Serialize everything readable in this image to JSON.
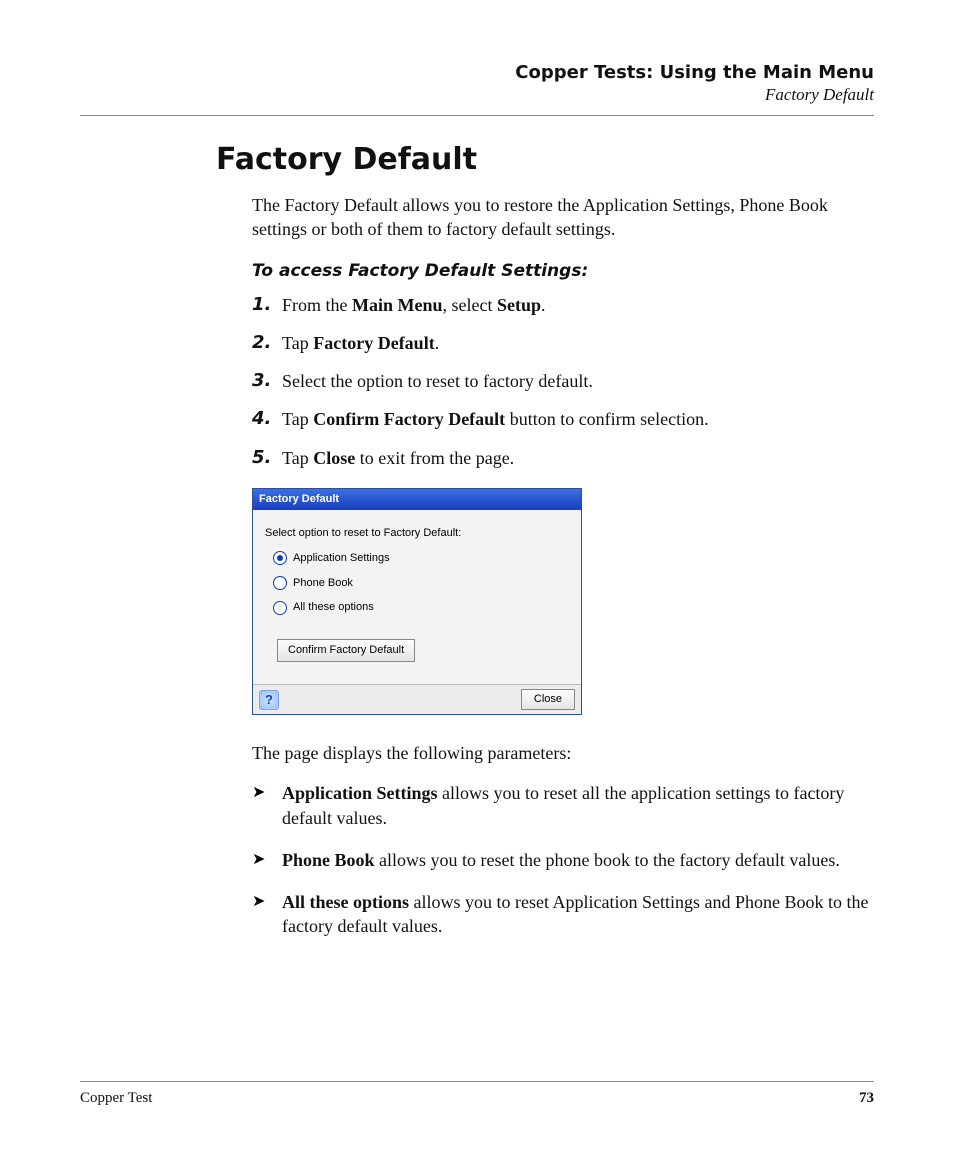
{
  "running_header": {
    "chapter": "Copper Tests: Using the Main Menu",
    "section": "Factory Default"
  },
  "title": "Factory Default",
  "intro": "The Factory Default allows you to restore the Application Settings, Phone Book settings or both of them to factory default settings.",
  "subhead": "To access Factory Default Settings:",
  "steps": [
    {
      "num": "1.",
      "pre": "From the ",
      "b1": "Main Menu",
      "mid": ", select ",
      "b2": "Setup",
      "post": "."
    },
    {
      "num": "2.",
      "pre": "Tap ",
      "b1": "Factory Default",
      "mid": "",
      "b2": "",
      "post": "."
    },
    {
      "num": "3.",
      "pre": "Select the option to reset to factory default.",
      "b1": "",
      "mid": "",
      "b2": "",
      "post": ""
    },
    {
      "num": "4.",
      "pre": "Tap ",
      "b1": "Confirm Factory Default",
      "mid": " button to confirm selection.",
      "b2": "",
      "post": ""
    },
    {
      "num": "5.",
      "pre": "Tap ",
      "b1": "Close",
      "mid": " to exit from the page.",
      "b2": "",
      "post": ""
    }
  ],
  "ui": {
    "title": "Factory Default",
    "prompt": "Select option to reset to Factory Default:",
    "options": [
      {
        "label": "Application Settings",
        "checked": true
      },
      {
        "label": "Phone Book",
        "checked": false
      },
      {
        "label": "All these options",
        "checked": false
      }
    ],
    "confirm_label": "Confirm Factory Default",
    "help_glyph": "?",
    "close_label": "Close"
  },
  "params_intro": "The page displays the following parameters:",
  "params": [
    {
      "b": "Application Settings",
      "rest": " allows you to reset all the application settings to factory default values."
    },
    {
      "b": "Phone Book",
      "rest": " allows you to reset the phone book to the factory default values."
    },
    {
      "b": "All these options",
      "rest": " allows you to reset Application Settings and Phone Book to the factory default values."
    }
  ],
  "footer": {
    "doc": "Copper Test",
    "page": "73"
  }
}
